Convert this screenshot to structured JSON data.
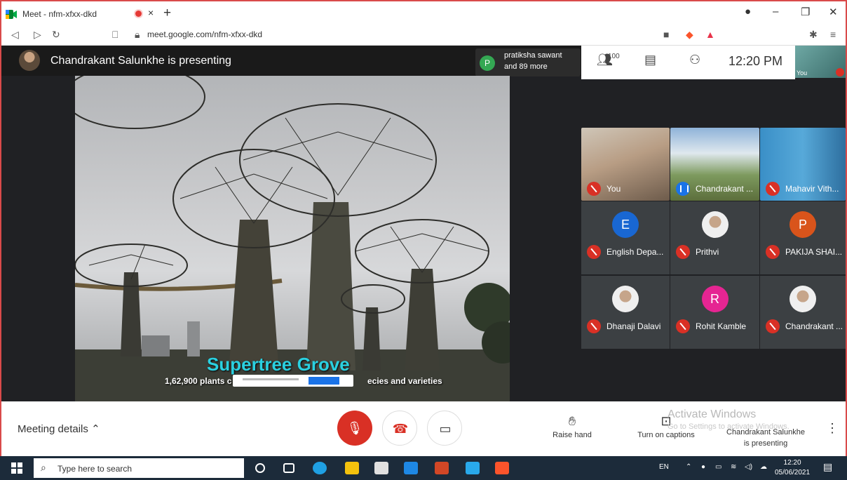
{
  "browser": {
    "tab_title": "Meet - nfm-xfxx-dkd",
    "tab_close": "×",
    "new_tab": "+",
    "url": "meet.google.com/nfm-xfxx-dkd",
    "window_controls": [
      "–",
      "❐",
      "✕"
    ]
  },
  "meet": {
    "presenter_banner": "Chandrakant Salunkhe is presenting",
    "people_popup": {
      "avatar_letter": "P",
      "line1": "pratiksha sawant",
      "line2": "and 89 more",
      "avatar_color": "#34a853"
    },
    "participant_count": "100",
    "clock": "12:20 PM",
    "self_label": "You",
    "slide": {
      "title": "Supertree Grove",
      "subtitle_start": "1,62,900 plants c",
      "subtitle_end": "ecies and varieties"
    },
    "participants": [
      {
        "name": "You",
        "type": "video",
        "muted": true
      },
      {
        "name": "Chandrakant ...",
        "type": "video",
        "muted": false
      },
      {
        "name": "Mahavir Vith...",
        "type": "video",
        "muted": true
      },
      {
        "name": "English Depa...",
        "type": "letter",
        "letter": "E",
        "color": "#1967d2",
        "muted": true
      },
      {
        "name": "Prithvi",
        "type": "photo",
        "muted": true
      },
      {
        "name": "PAKIJA SHAI...",
        "type": "letter",
        "letter": "P",
        "color": "#d9541b",
        "muted": true
      },
      {
        "name": "Dhanaji Dalavi",
        "type": "photo",
        "muted": true
      },
      {
        "name": "Rohit Kamble",
        "type": "letter",
        "letter": "R",
        "color": "#e52592",
        "muted": true
      },
      {
        "name": "Chandrakant ...",
        "type": "photo",
        "muted": true
      }
    ]
  },
  "bottom_bar": {
    "meeting_details": "Meeting details",
    "raise_hand": "Raise hand",
    "captions": "Turn on captions",
    "activate_windows": "Activate Windows",
    "activate_sub": "Go to Settings to activate Windows.",
    "presenting_status_line1": "Chandrakant Salunkhe",
    "presenting_status_line2": "is presenting",
    "more": "⋮"
  },
  "taskbar": {
    "search_placeholder": "Type here to search",
    "language": "EN",
    "time": "12:20",
    "date": "05/06/2021"
  },
  "colors": {
    "accent_red": "#d93025",
    "meet_bg": "#202124",
    "taskbar_bg": "#1c2b3a"
  }
}
